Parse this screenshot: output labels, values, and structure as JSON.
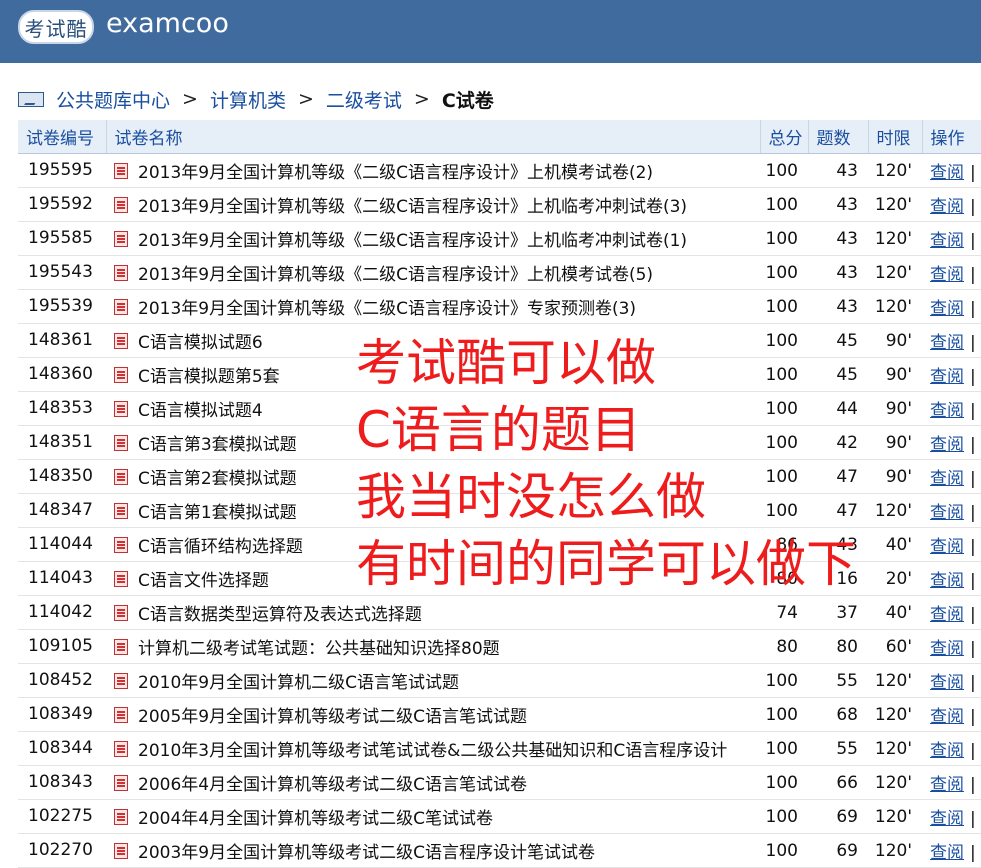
{
  "header": {
    "logo_text": "考试酷",
    "brand": "examcoo"
  },
  "breadcrumb": {
    "links": [
      "公共题库中心",
      "计算机类",
      "二级考试"
    ],
    "separator": ">",
    "current": "C试卷"
  },
  "table": {
    "columns": {
      "id": "试卷编号",
      "name": "试卷名称",
      "score": "总分",
      "count": "题数",
      "time": "时限",
      "action": "操作"
    },
    "action_label": "查阅",
    "action_separator": "|",
    "rows": [
      {
        "id": "195595",
        "name": "2013年9月全国计算机等级《二级C语言程序设计》上机模考试卷(2)",
        "score": "100",
        "count": "43",
        "time": "120'"
      },
      {
        "id": "195592",
        "name": "2013年9月全国计算机等级《二级C语言程序设计》上机临考冲刺试卷(3)",
        "score": "100",
        "count": "43",
        "time": "120'"
      },
      {
        "id": "195585",
        "name": "2013年9月全国计算机等级《二级C语言程序设计》上机临考冲刺试卷(1)",
        "score": "100",
        "count": "43",
        "time": "120'"
      },
      {
        "id": "195543",
        "name": "2013年9月全国计算机等级《二级C语言程序设计》上机模考试卷(5)",
        "score": "100",
        "count": "43",
        "time": "120'"
      },
      {
        "id": "195539",
        "name": "2013年9月全国计算机等级《二级C语言程序设计》专家预测卷(3)",
        "score": "100",
        "count": "43",
        "time": "120'"
      },
      {
        "id": "148361",
        "name": "C语言模拟试题6",
        "score": "100",
        "count": "45",
        "time": "90'"
      },
      {
        "id": "148360",
        "name": "C语言模拟题第5套",
        "score": "100",
        "count": "45",
        "time": "90'"
      },
      {
        "id": "148353",
        "name": "C语言模拟试题4",
        "score": "100",
        "count": "44",
        "time": "90'"
      },
      {
        "id": "148351",
        "name": "C语言第3套模拟试题",
        "score": "100",
        "count": "42",
        "time": "90'"
      },
      {
        "id": "148350",
        "name": "C语言第2套模拟试题",
        "score": "100",
        "count": "47",
        "time": "90'"
      },
      {
        "id": "148347",
        "name": "C语言第1套模拟试题",
        "score": "100",
        "count": "47",
        "time": "120'"
      },
      {
        "id": "114044",
        "name": "C语言循环结构选择题",
        "score": "86",
        "count": "43",
        "time": "40'"
      },
      {
        "id": "114043",
        "name": "C语言文件选择题",
        "score": "80",
        "count": "16",
        "time": "20'"
      },
      {
        "id": "114042",
        "name": "C语言数据类型运算符及表达式选择题",
        "score": "74",
        "count": "37",
        "time": "40'"
      },
      {
        "id": "109105",
        "name": "计算机二级考试笔试题：公共基础知识选择80题",
        "score": "80",
        "count": "80",
        "time": "60'"
      },
      {
        "id": "108452",
        "name": "2010年9月全国计算机二级C语言笔试试题",
        "score": "100",
        "count": "55",
        "time": "120'"
      },
      {
        "id": "108349",
        "name": "2005年9月全国计算机等级考试二级C语言笔试试题",
        "score": "100",
        "count": "68",
        "time": "120'"
      },
      {
        "id": "108344",
        "name": "2010年3月全国计算机等级考试笔试试卷&二级公共基础知识和C语言程序设计",
        "score": "100",
        "count": "55",
        "time": "120'"
      },
      {
        "id": "108343",
        "name": "2006年4月全国计算机等级考试二级C语言笔试试卷",
        "score": "100",
        "count": "66",
        "time": "120'"
      },
      {
        "id": "102275",
        "name": "2004年4月全国计算机等级考试二级C笔试试卷",
        "score": "100",
        "count": "69",
        "time": "120'"
      },
      {
        "id": "102270",
        "name": "2003年9月全国计算机等级考试二级C语言程序设计笔试试卷",
        "score": "100",
        "count": "69",
        "time": "120'"
      }
    ]
  },
  "overlay_lines": [
    "考试酷可以做",
    "C语言的题目",
    "我当时没怎么做",
    "有时间的同学可以做下"
  ],
  "colors": {
    "header": "#3f6b9e",
    "link": "#1a4fa0",
    "overlay": "#ee1c1c"
  }
}
